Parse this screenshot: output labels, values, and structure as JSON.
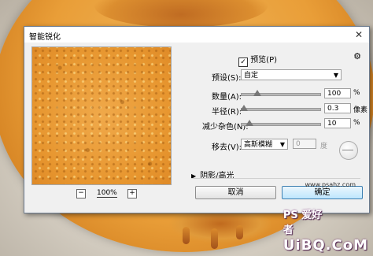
{
  "dialog": {
    "title": "智能锐化",
    "close_glyph": "✕",
    "preview_label": "预览(P)",
    "preview_checked": true,
    "preset": {
      "label": "预设(S):",
      "value": "自定"
    },
    "amount": {
      "label": "数量(A):",
      "value": "100",
      "unit": "%",
      "level": 0.2
    },
    "radius": {
      "label": "半径(R):",
      "value": "0.3",
      "unit": "像素",
      "level": 0.03
    },
    "noise": {
      "label": "减少杂色(N):",
      "value": "10",
      "unit": "%",
      "level": 0.1
    },
    "remove": {
      "label": "移去(V):",
      "value": "高斯模糊",
      "angle_value": "0",
      "angle_unit": "度"
    },
    "section_label": "阴影/高光",
    "zoom": {
      "out": "−",
      "value": "100%",
      "in": "+"
    },
    "buttons": {
      "cancel": "取消",
      "ok": "确定"
    }
  },
  "watermark": {
    "brand": "UiBQ.CoM",
    "ps": "PS 爱好者",
    "url": "www.psahz.com"
  }
}
